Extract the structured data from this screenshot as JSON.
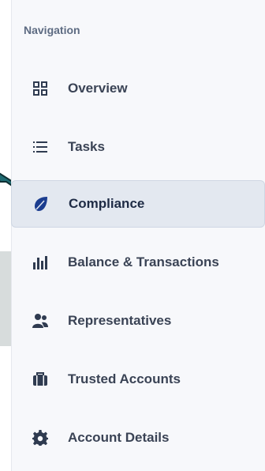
{
  "sidebar": {
    "heading": "Navigation",
    "items": [
      {
        "label": "Overview",
        "icon": "grid-icon",
        "active": false
      },
      {
        "label": "Tasks",
        "icon": "list-icon",
        "active": false
      },
      {
        "label": "Compliance",
        "icon": "leaf-icon",
        "active": true
      },
      {
        "label": "Balance & Transactions",
        "icon": "bar-chart-icon",
        "active": false
      },
      {
        "label": "Representatives",
        "icon": "users-icon",
        "active": false
      },
      {
        "label": "Trusted Accounts",
        "icon": "briefcase-icon",
        "active": false
      },
      {
        "label": "Account Details",
        "icon": "gear-icon",
        "active": false
      }
    ]
  },
  "colors": {
    "accent": "#1b3d8f",
    "pointer": "#1f6b72",
    "active_bg": "#e3e8f0"
  }
}
